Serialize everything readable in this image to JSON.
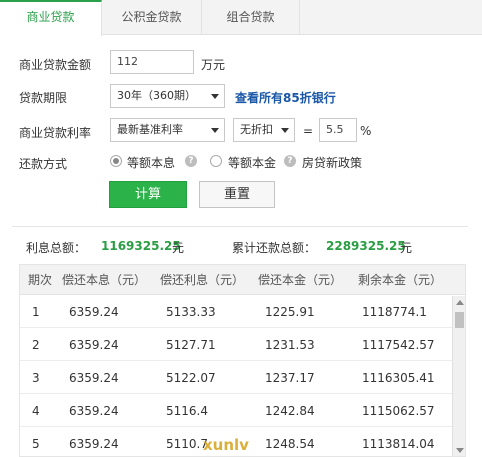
{
  "tabs": [
    "商业贷款",
    "公积金贷款",
    "组合贷款"
  ],
  "form": {
    "amount_label": "商业贷款金额",
    "amount_value": "112",
    "amount_unit": "万元",
    "term_label": "贷款期限",
    "term_value": "30年（360期）",
    "bank_link": "查看所有85折银行",
    "rate_label": "商业贷款利率",
    "rate_type": "最新基准利率",
    "discount": "无折扣",
    "equals": "=",
    "rate_value": "5.5",
    "rate_unit": "%",
    "method_label": "还款方式",
    "method_options": [
      "等额本息",
      "等额本金"
    ],
    "method_selected": "等额本息",
    "policy_text": "房贷新政策",
    "help_glyph": "?",
    "calc_button": "计算",
    "reset_button": "重置"
  },
  "summary": {
    "interest_label": "利息总额：",
    "interest_value": "1169325.25",
    "interest_unit": "元",
    "total_label": "累计还款总额：",
    "total_value": "2289325.25",
    "total_unit": "元"
  },
  "table": {
    "headers": [
      "期次",
      "偿还本息（元）",
      "偿还利息（元）",
      "偿还本金（元）",
      "剩余本金（元）"
    ],
    "rows": [
      [
        "1",
        "6359.24",
        "5133.33",
        "1225.91",
        "1118774.1"
      ],
      [
        "2",
        "6359.24",
        "5127.71",
        "1231.53",
        "1117542.57"
      ],
      [
        "3",
        "6359.24",
        "5122.07",
        "1237.17",
        "1116305.41"
      ],
      [
        "4",
        "6359.24",
        "5116.4",
        "1242.84",
        "1115062.57"
      ],
      [
        "5",
        "6359.24",
        "5110.7",
        "1248.54",
        "1113814.04"
      ]
    ]
  },
  "watermark": "xunlv",
  "colors": {
    "accent_green": "#2bb34a",
    "value_green": "#2a9e43",
    "link_blue": "#1a57a7"
  }
}
